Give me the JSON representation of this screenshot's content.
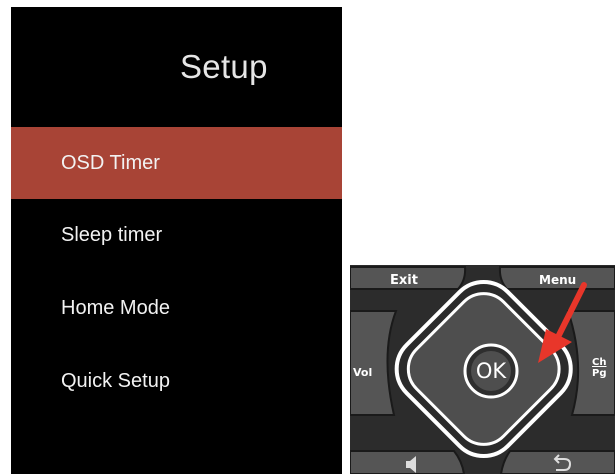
{
  "menu": {
    "title": "Setup",
    "items": [
      {
        "label": "OSD Timer",
        "selected": true
      },
      {
        "label": "Sleep timer",
        "selected": false
      },
      {
        "label": "Home Mode",
        "selected": false
      },
      {
        "label": "Quick Setup",
        "selected": false
      }
    ],
    "highlight_color": "#a84436"
  },
  "remote": {
    "exit_label": "Exit",
    "menu_label": "Menu",
    "vol_label": "Vol",
    "ok_label": "OK",
    "ch_label": "Ch",
    "pg_label": "Pg",
    "arrow_color": "#e8362a",
    "icons": [
      "mute-icon",
      "back-icon",
      "arrow-pointer-icon"
    ]
  }
}
